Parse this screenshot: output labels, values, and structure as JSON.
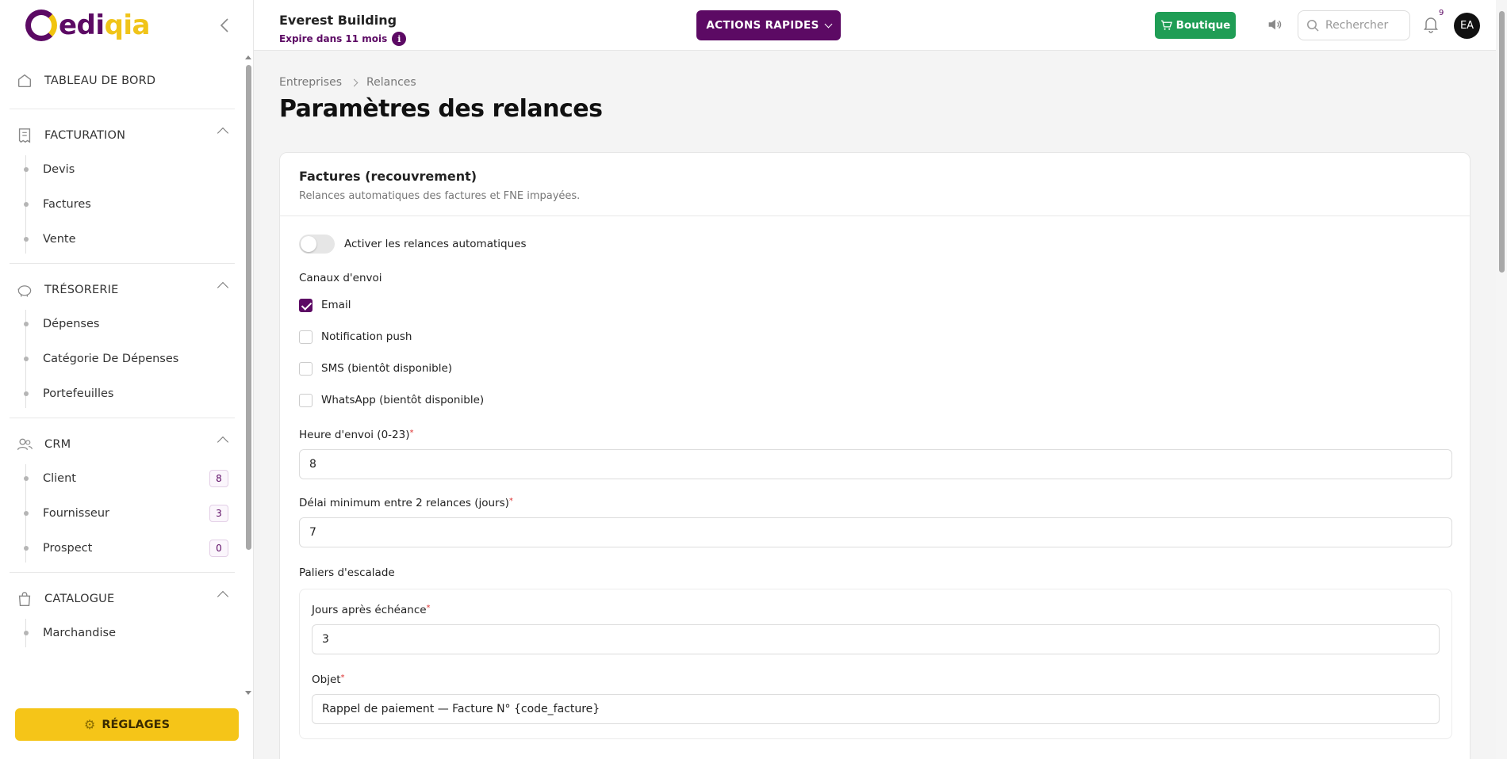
{
  "brand": {
    "logo_part1": "edi",
    "logo_part2": "qia"
  },
  "sidebar": {
    "dashboard": "TABLEAU DE BORD",
    "sections": [
      {
        "label": "FACTURATION",
        "items": [
          {
            "label": "Devis"
          },
          {
            "label": "Factures"
          },
          {
            "label": "Vente"
          }
        ]
      },
      {
        "label": "TRÉSORERIE",
        "items": [
          {
            "label": "Dépenses"
          },
          {
            "label": "Catégorie De Dépenses"
          },
          {
            "label": "Portefeuilles"
          }
        ]
      },
      {
        "label": "CRM",
        "items": [
          {
            "label": "Client",
            "count": "8"
          },
          {
            "label": "Fournisseur",
            "count": "3"
          },
          {
            "label": "Prospect",
            "count": "0"
          }
        ]
      },
      {
        "label": "CATALOGUE",
        "items": [
          {
            "label": "Marchandise"
          }
        ]
      }
    ],
    "settings": "RÉGLAGES"
  },
  "header": {
    "company": "Everest Building",
    "expires": "Expire dans 11 mois",
    "quick_actions": "ACTIONS RAPIDES",
    "shop": "Boutique",
    "search_placeholder": "Rechercher",
    "notif_count": "9",
    "avatar": "EA"
  },
  "breadcrumb": [
    "Entreprises",
    "Relances"
  ],
  "page_title": "Paramètres des relances",
  "card": {
    "title": "Factures (recouvrement)",
    "subtitle": "Relances automatiques des factures et FNE impayées.",
    "toggle_label": "Activer les relances automatiques",
    "toggle_on": false,
    "channels_title": "Canaux d'envoi",
    "channels": [
      {
        "label": "Email",
        "checked": true
      },
      {
        "label": "Notification push",
        "checked": false
      },
      {
        "label": "SMS (bientôt disponible)",
        "checked": false
      },
      {
        "label": "WhatsApp (bientôt disponible)",
        "checked": false
      }
    ],
    "send_hour_label": "Heure d'envoi (0-23)",
    "send_hour_value": "8",
    "min_delay_label": "Délai minimum entre 2 relances (jours)",
    "min_delay_value": "7",
    "tiers_title": "Paliers d'escalade",
    "tier": {
      "days_label": "Jours après échéance",
      "days_value": "3",
      "subject_label": "Objet",
      "subject_value": "Rappel de paiement — Facture N° {code_facture}"
    }
  },
  "colors": {
    "primary": "#5c0a64",
    "accent": "#f5c518",
    "success": "#1f9d55"
  }
}
